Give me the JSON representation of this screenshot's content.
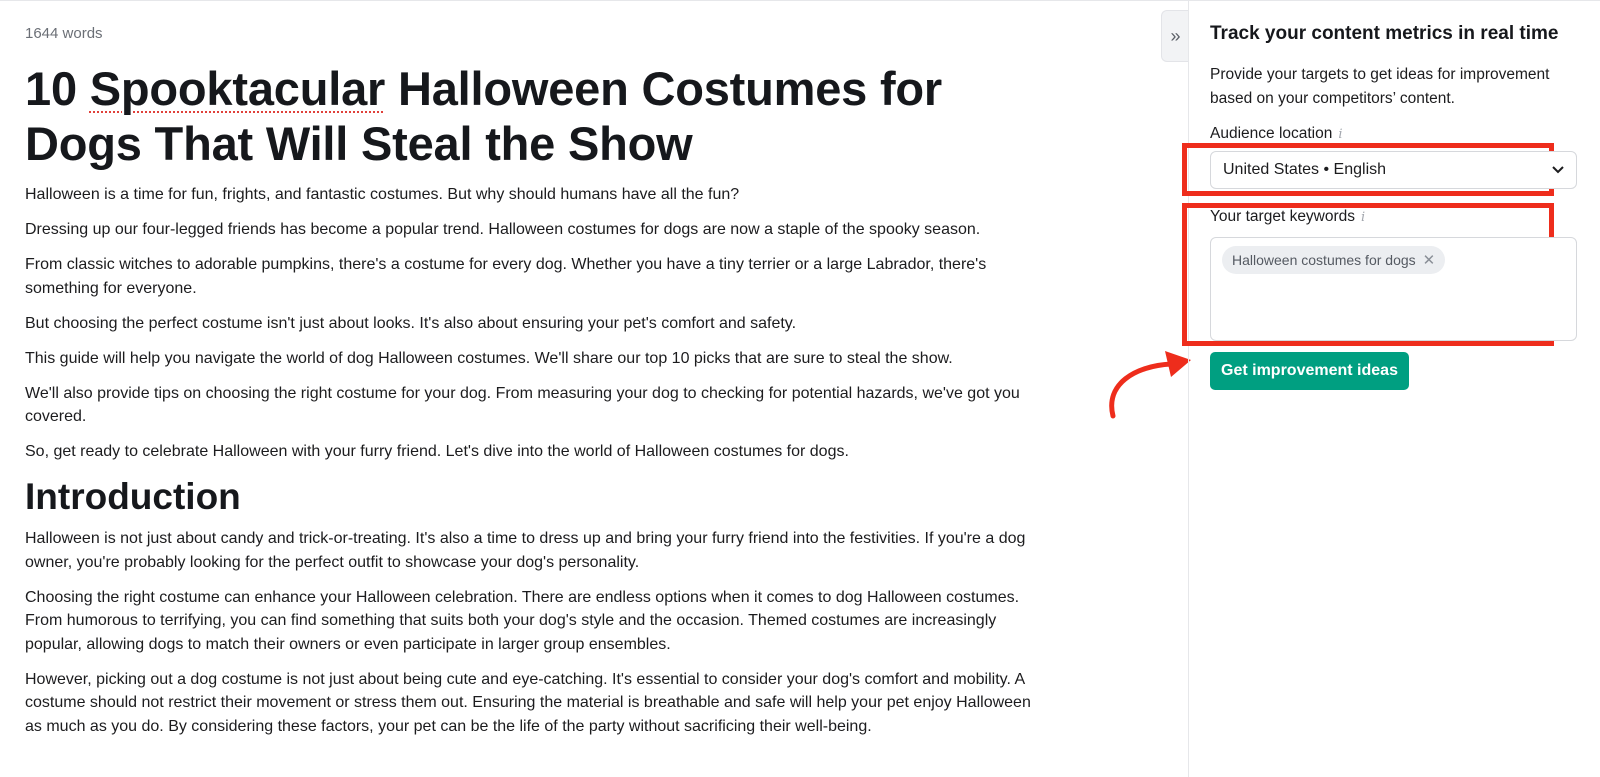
{
  "editor": {
    "word_count": "1644 words",
    "title_pre": "10 ",
    "title_flagged": "Spooktacular",
    "title_post": " Halloween Costumes for Dogs That Will Steal the Show",
    "intro_paragraphs": [
      "Halloween is a time for fun, frights, and fantastic costumes. But why should humans have all the fun?",
      "Dressing up our four-legged friends has become a popular trend. Halloween costumes for dogs are now a staple of the spooky season.",
      "From classic witches to adorable pumpkins, there's a costume for every dog. Whether you have a tiny terrier or a large Labrador, there's something for everyone.",
      "But choosing the perfect costume isn't just about looks. It's also about ensuring your pet's comfort and safety.",
      "This guide will help you navigate the world of dog Halloween costumes. We'll share our top 10 picks that are sure to steal the show.",
      "We'll also provide tips on choosing the right costume for your dog. From measuring your dog to checking for potential hazards, we've got you covered.",
      "So, get ready to celebrate Halloween with your furry friend. Let's dive into the world of Halloween costumes for dogs."
    ],
    "section_heading": "Introduction",
    "section_paragraphs": [
      "Halloween is not just about candy and trick-or-treating. It's also a time to dress up and bring your furry friend into the festivities. If you're a dog owner, you're probably looking for the perfect outfit to showcase your dog's personality.",
      "Choosing the right costume can enhance your Halloween celebration. There are endless options when it comes to dog Halloween costumes. From humorous to terrifying, you can find something that suits both your dog's style and the occasion. Themed costumes are increasingly popular, allowing dogs to match their owners or even participate in larger group ensembles.",
      "However, picking out a dog costume is not just about being cute and eye-catching. It's essential to consider your dog's comfort and mobility. A costume should not restrict their movement or stress them out. Ensuring the material is breathable and safe will help your pet enjoy Halloween as much as you do. By considering these factors, your pet can be the life of the party without sacrificing their well-being."
    ]
  },
  "collapse_button": {
    "icon": "double-chevron-right-icon",
    "glyph": "»"
  },
  "panel": {
    "title": "Track your content metrics in real time",
    "description": "Provide your targets to get ideas for improvement based on your competitors’ content.",
    "audience_label": "Audience location",
    "info_glyph": "i",
    "audience_value": "United States • English",
    "keywords_label": "Your target keywords",
    "keywords": [
      "Halloween costumes for dogs"
    ],
    "chip_remove_glyph": "✕",
    "cta_label": "Get improvement ideas"
  },
  "colors": {
    "accent_button": "#009f81",
    "highlight_annotation": "#ee2d1c"
  }
}
